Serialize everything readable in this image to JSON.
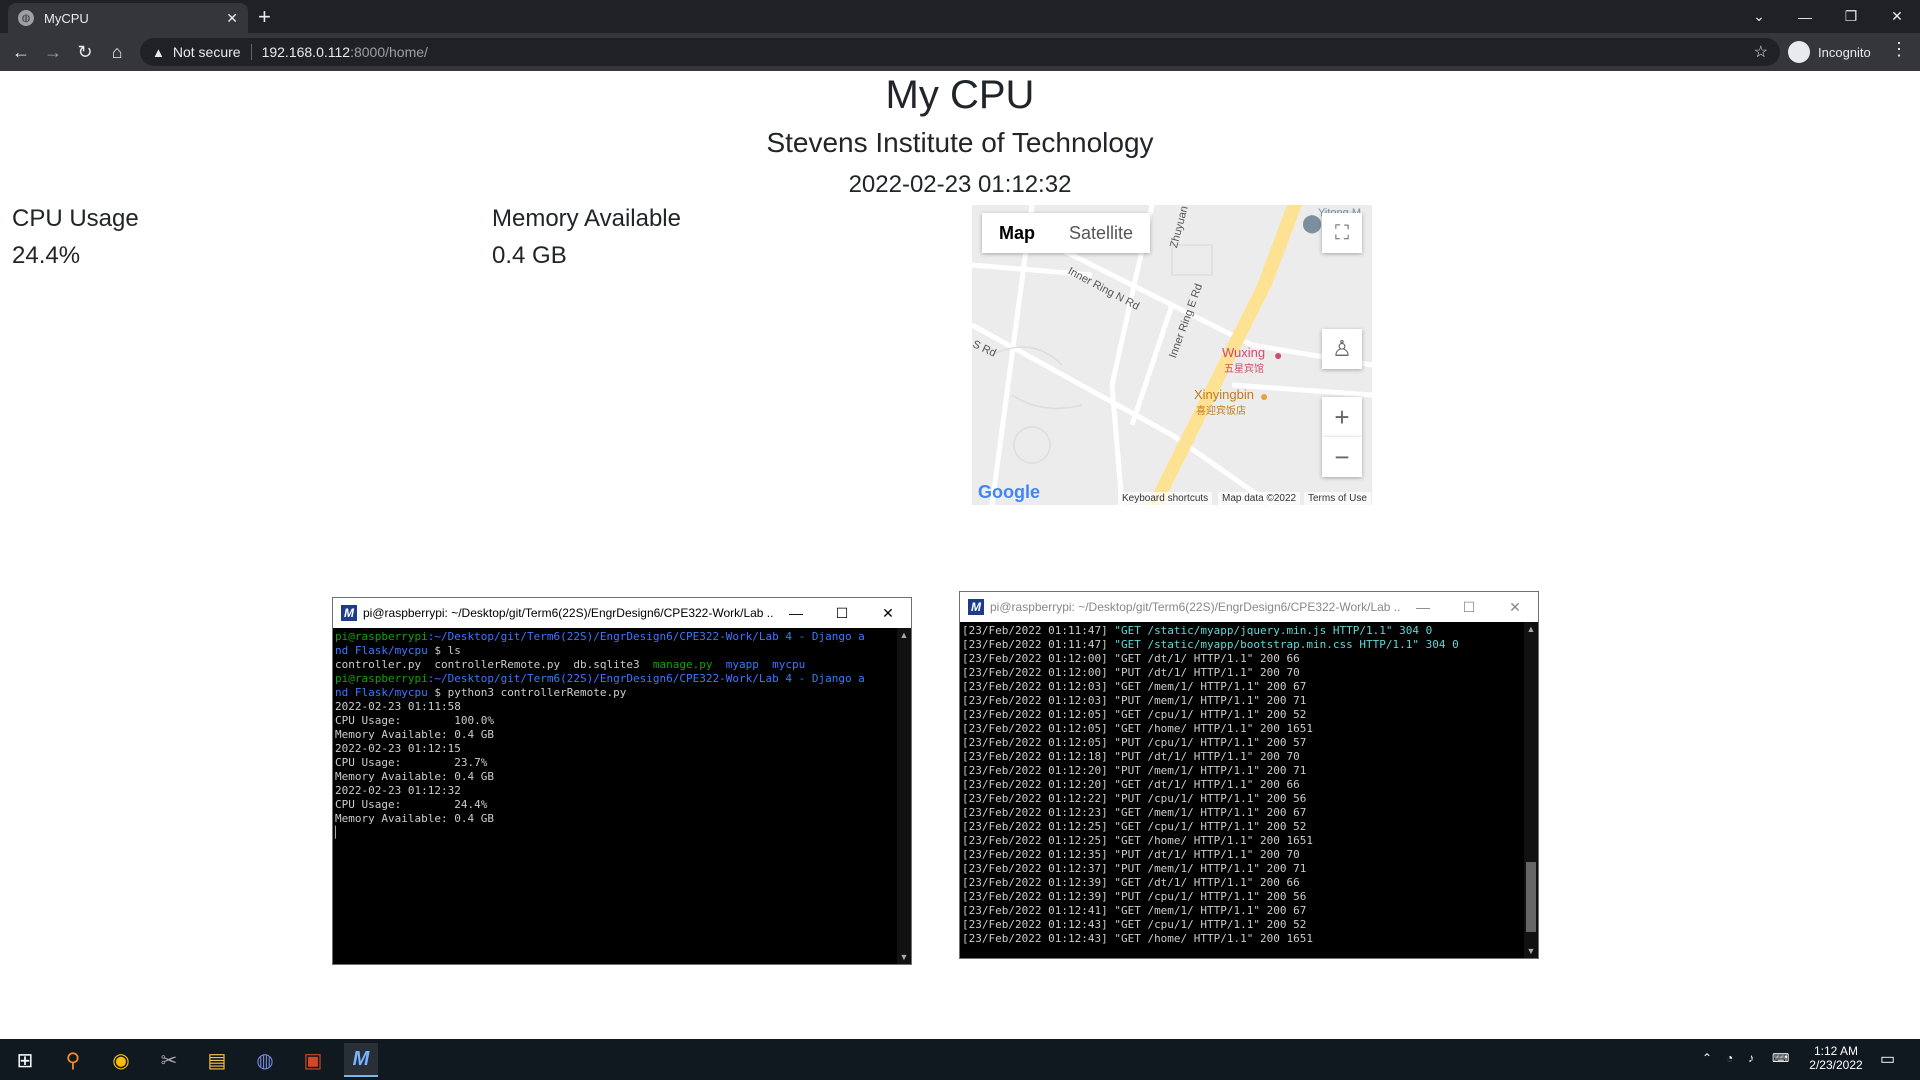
{
  "browser": {
    "tab_title": "MyCPU",
    "tab_close": "✕",
    "new_tab": "+",
    "security": "Not secure",
    "url_host": "192.168.0.112",
    "url_path": ":8000/home/",
    "profile": "Incognito"
  },
  "page": {
    "title": "My CPU",
    "subtitle": "Stevens Institute of Technology",
    "timestamp": "2022-02-23 01:12:32",
    "cpu_label": "CPU Usage",
    "cpu_value": "24.4%",
    "mem_label": "Memory Available",
    "mem_value": "0.4 GB"
  },
  "map": {
    "type_map": "Map",
    "type_satellite": "Satellite",
    "zoom_in": "+",
    "zoom_out": "−",
    "google": "Google",
    "shortcuts": "Keyboard shortcuts",
    "map_data": "Map data ©2022",
    "terms": "Terms of Use",
    "labels": [
      "Inner Ring N Rd",
      "Inner Ring E Rd",
      "Zhuyuan",
      "S Rd",
      "Yitong M",
      "Wuxing",
      "五星宾馆",
      "Xinyingbin",
      "喜迎宾饭店"
    ]
  },
  "terminal1": {
    "title": "pi@raspberrypi: ~/Desktop/git/Term6(22S)/EngrDesign6/CPE322-Work/Lab ...",
    "lines": [
      {
        "prompt": "pi@raspberrypi",
        "path": ":~/Desktop/git/Term6(22S)/EngrDesign6/CPE322-Work/Lab 4 - Django a",
        "cmd": ""
      },
      {
        "text": "nd Flask/mycpu",
        "suffix": " $ ls"
      },
      {
        "files": [
          "controller.py",
          "controllerRemote.py",
          "db.sqlite3",
          "manage.py",
          "myapp",
          "mycpu"
        ]
      },
      {
        "prompt": "pi@raspberrypi",
        "path": ":~/Desktop/git/Term6(22S)/EngrDesign6/CPE322-Work/Lab 4 - Django a",
        "cmd": ""
      },
      {
        "text": "nd Flask/mycpu",
        "suffix": " $ python3 controllerRemote.py"
      },
      {
        "out": "2022-02-23 01:11:58"
      },
      {
        "out": "CPU Usage:        100.0%"
      },
      {
        "out": "Memory Available: 0.4 GB"
      },
      {
        "out": "2022-02-23 01:12:15"
      },
      {
        "out": "CPU Usage:        23.7%"
      },
      {
        "out": "Memory Available: 0.4 GB"
      },
      {
        "out": "2022-02-23 01:12:32"
      },
      {
        "out": "CPU Usage:        24.4%"
      },
      {
        "out": "Memory Available: 0.4 GB"
      }
    ]
  },
  "terminal2": {
    "title": "pi@raspberrypi: ~/Desktop/git/Term6(22S)/EngrDesign6/CPE322-Work/Lab ...",
    "lines": [
      {
        "ts": "[23/Feb/2022 01:11:47]",
        "req": "\"GET /static/myapp/jquery.min.js HTTP/1.1\" 304 0",
        "hl": true
      },
      {
        "ts": "[23/Feb/2022 01:11:47]",
        "req": "\"GET /static/myapp/bootstrap.min.css HTTP/1.1\" 304 0",
        "hl": true
      },
      {
        "ts": "[23/Feb/2022 01:12:00]",
        "req": "\"GET /dt/1/ HTTP/1.1\" 200 66"
      },
      {
        "ts": "[23/Feb/2022 01:12:00]",
        "req": "\"PUT /dt/1/ HTTP/1.1\" 200 70"
      },
      {
        "ts": "[23/Feb/2022 01:12:03]",
        "req": "\"GET /mem/1/ HTTP/1.1\" 200 67"
      },
      {
        "ts": "[23/Feb/2022 01:12:03]",
        "req": "\"PUT /mem/1/ HTTP/1.1\" 200 71"
      },
      {
        "ts": "[23/Feb/2022 01:12:05]",
        "req": "\"GET /cpu/1/ HTTP/1.1\" 200 52"
      },
      {
        "ts": "[23/Feb/2022 01:12:05]",
        "req": "\"GET /home/ HTTP/1.1\" 200 1651"
      },
      {
        "ts": "[23/Feb/2022 01:12:05]",
        "req": "\"PUT /cpu/1/ HTTP/1.1\" 200 57"
      },
      {
        "ts": "[23/Feb/2022 01:12:18]",
        "req": "\"PUT /dt/1/ HTTP/1.1\" 200 70"
      },
      {
        "ts": "[23/Feb/2022 01:12:20]",
        "req": "\"PUT /mem/1/ HTTP/1.1\" 200 71"
      },
      {
        "ts": "[23/Feb/2022 01:12:20]",
        "req": "\"GET /dt/1/ HTTP/1.1\" 200 66"
      },
      {
        "ts": "[23/Feb/2022 01:12:22]",
        "req": "\"PUT /cpu/1/ HTTP/1.1\" 200 56"
      },
      {
        "ts": "[23/Feb/2022 01:12:23]",
        "req": "\"GET /mem/1/ HTTP/1.1\" 200 67"
      },
      {
        "ts": "[23/Feb/2022 01:12:25]",
        "req": "\"GET /cpu/1/ HTTP/1.1\" 200 52"
      },
      {
        "ts": "[23/Feb/2022 01:12:25]",
        "req": "\"GET /home/ HTTP/1.1\" 200 1651"
      },
      {
        "ts": "[23/Feb/2022 01:12:35]",
        "req": "\"PUT /dt/1/ HTTP/1.1\" 200 70"
      },
      {
        "ts": "[23/Feb/2022 01:12:37]",
        "req": "\"PUT /mem/1/ HTTP/1.1\" 200 71"
      },
      {
        "ts": "[23/Feb/2022 01:12:39]",
        "req": "\"GET /dt/1/ HTTP/1.1\" 200 66"
      },
      {
        "ts": "[23/Feb/2022 01:12:39]",
        "req": "\"PUT /cpu/1/ HTTP/1.1\" 200 56"
      },
      {
        "ts": "[23/Feb/2022 01:12:41]",
        "req": "\"GET /mem/1/ HTTP/1.1\" 200 67"
      },
      {
        "ts": "[23/Feb/2022 01:12:43]",
        "req": "\"GET /cpu/1/ HTTP/1.1\" 200 52"
      },
      {
        "ts": "[23/Feb/2022 01:12:43]",
        "req": "\"GET /home/ HTTP/1.1\" 200 1651"
      }
    ]
  },
  "taskbar": {
    "time": "1:12 AM",
    "date": "2/23/2022"
  }
}
